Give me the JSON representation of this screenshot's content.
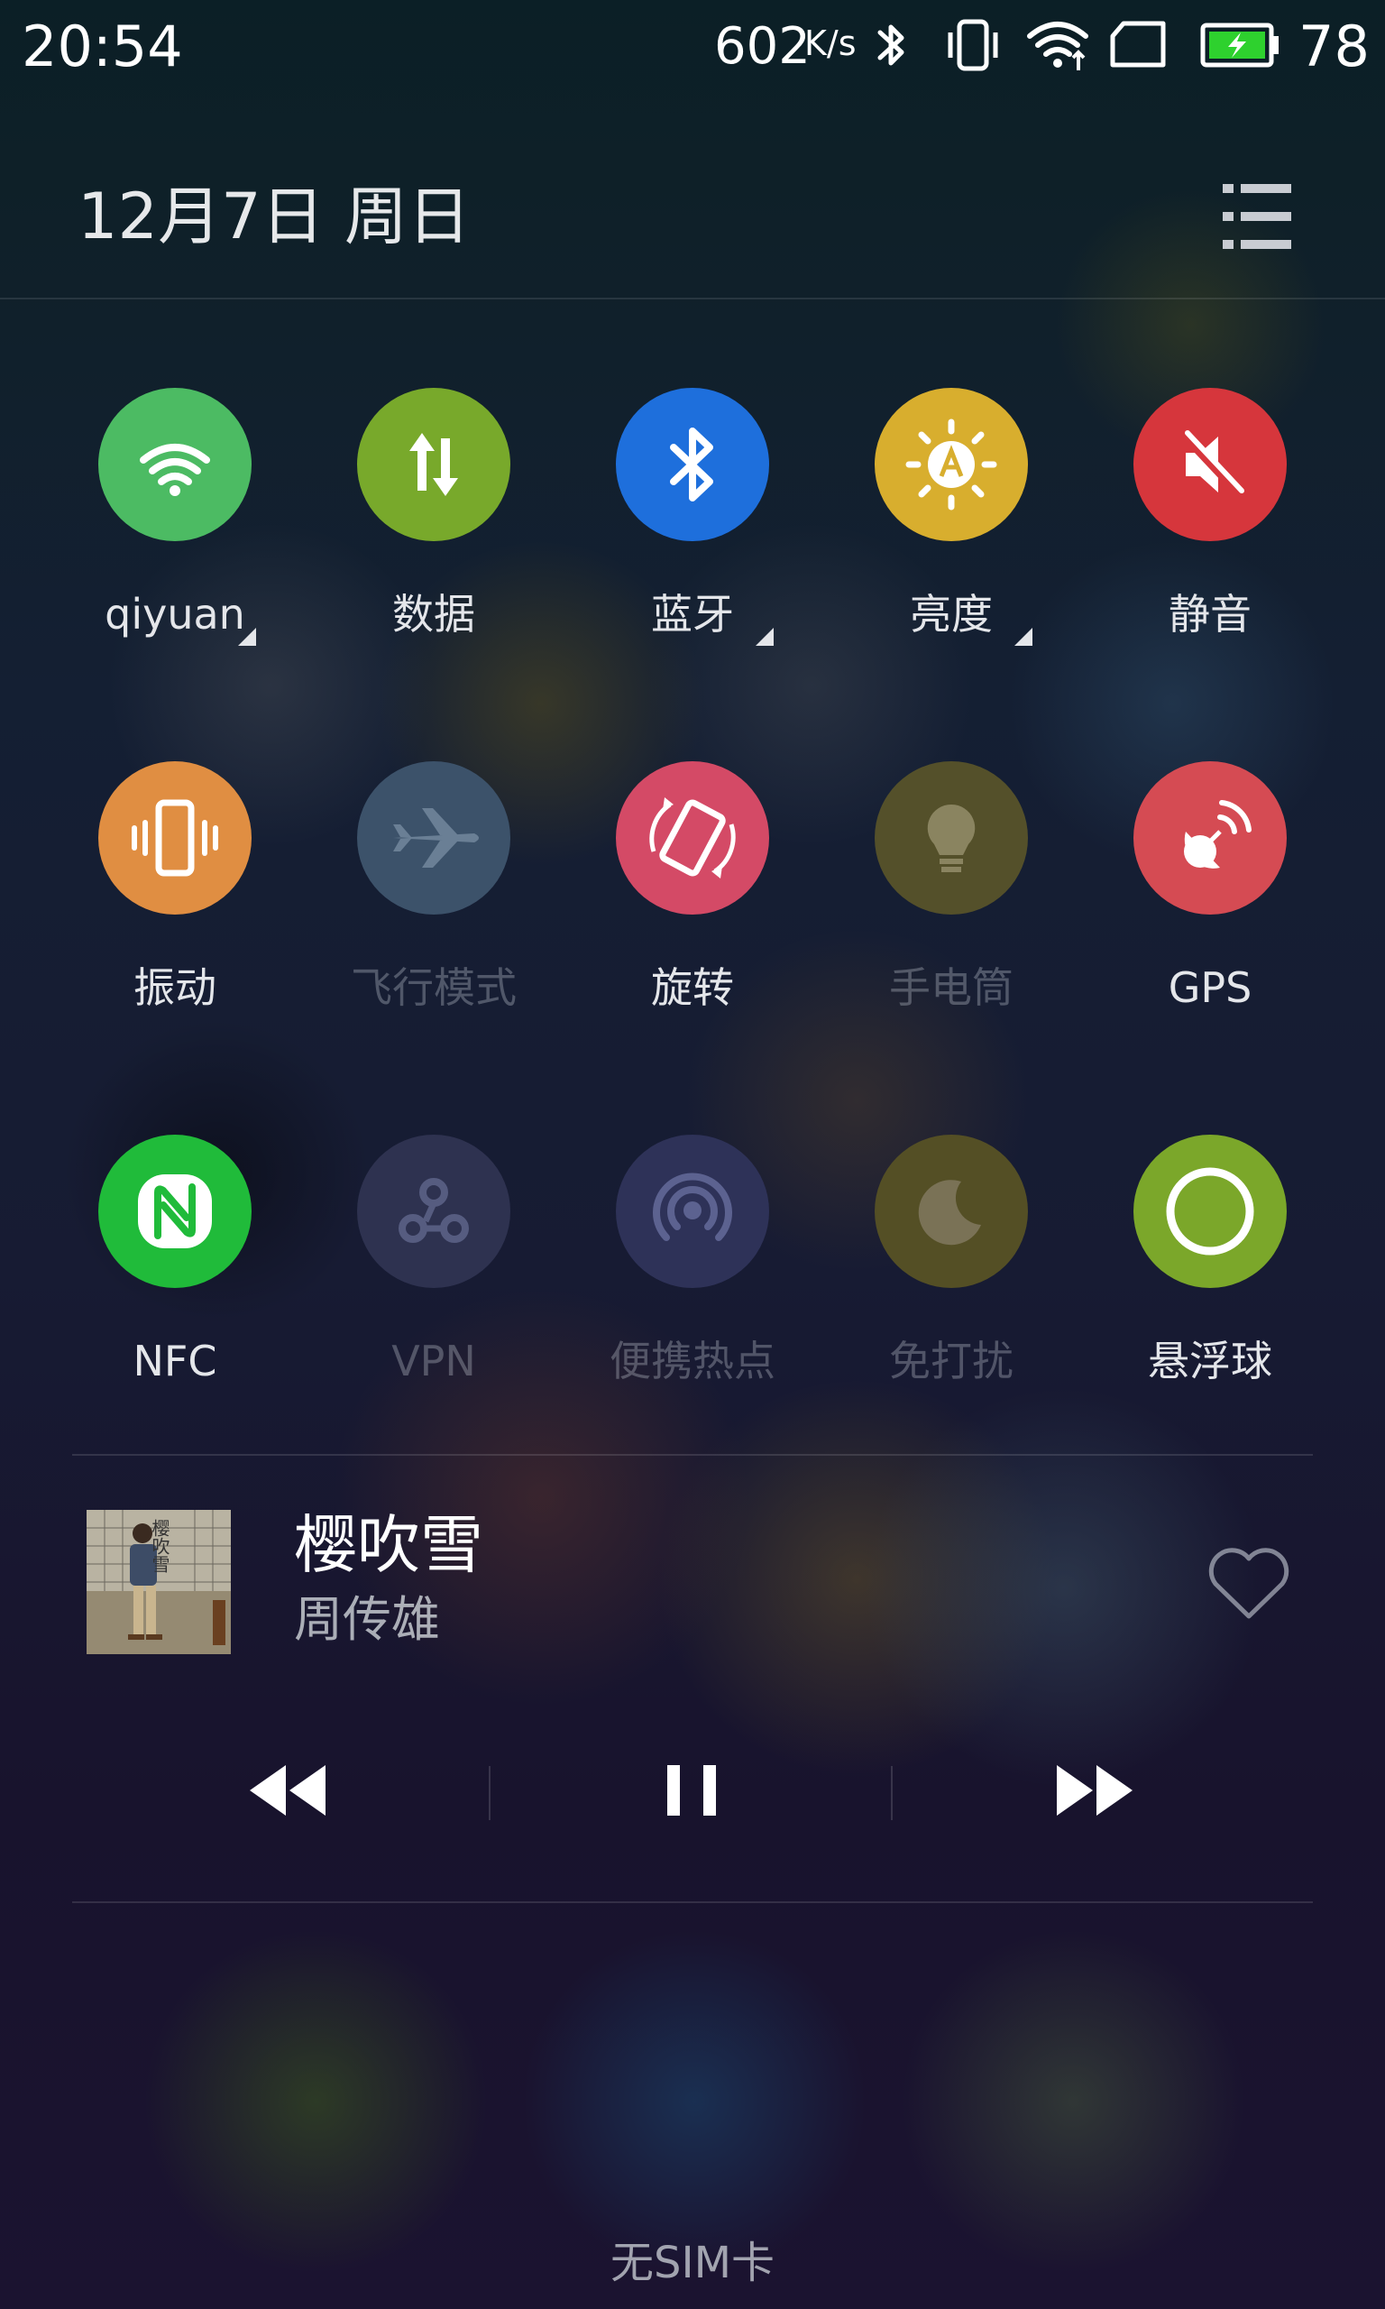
{
  "status_bar": {
    "time": "20:54",
    "net_speed": "602",
    "net_speed_unit": "K/s",
    "battery_level": "78",
    "battery_color": "#2ed12e",
    "icons": [
      "bluetooth-icon",
      "vibrate-icon",
      "wifi-icon",
      "no-sim-icon",
      "battery-charging-icon"
    ]
  },
  "header": {
    "date": "12月7日  周日",
    "menu_icon": "list-icon"
  },
  "toggles": [
    {
      "label": "qiyuan",
      "icon": "wifi-icon",
      "color": "#4cbb63",
      "active": true,
      "has_caret": true
    },
    {
      "label": "数据",
      "icon": "data-icon",
      "color": "#78a92b",
      "active": true,
      "has_caret": false
    },
    {
      "label": "蓝牙",
      "icon": "bluetooth-icon",
      "color": "#1e6fdc",
      "active": true,
      "has_caret": true
    },
    {
      "label": "亮度",
      "icon": "brightness-auto-icon",
      "color": "#d8ae2e",
      "active": true,
      "has_caret": true
    },
    {
      "label": "静音",
      "icon": "mute-icon",
      "color": "#d6363c",
      "active": true,
      "has_caret": false
    },
    {
      "label": "振动",
      "icon": "vibrate-icon",
      "color": "#e08e42",
      "active": true,
      "has_caret": false
    },
    {
      "label": "飞行模式",
      "icon": "airplane-icon",
      "color": "#3c526a",
      "active": false,
      "has_caret": false
    },
    {
      "label": "旋转",
      "icon": "rotate-icon",
      "color": "#d44a66",
      "active": true,
      "has_caret": false
    },
    {
      "label": "手电筒",
      "icon": "flashlight-icon",
      "color": "#54502a",
      "active": false,
      "has_caret": false
    },
    {
      "label": "GPS",
      "icon": "gps-icon",
      "color": "#d54b53",
      "active": true,
      "has_caret": false
    },
    {
      "label": "NFC",
      "icon": "nfc-icon",
      "color": "#20bb3a",
      "active": true,
      "has_caret": false
    },
    {
      "label": "VPN",
      "icon": "vpn-icon",
      "color": "#2e3250",
      "active": false,
      "has_caret": false
    },
    {
      "label": "便携热点",
      "icon": "hotspot-icon",
      "color": "#2e3258",
      "active": false,
      "has_caret": false
    },
    {
      "label": "免打扰",
      "icon": "moon-icon",
      "color": "#544f25",
      "active": false,
      "has_caret": false
    },
    {
      "label": "悬浮球",
      "icon": "floating-ball-icon",
      "color": "#7ba72a",
      "active": true,
      "has_caret": false
    }
  ],
  "music": {
    "title": "樱吹雪",
    "artist": "周传雄",
    "album_art_text": "樱吹雪",
    "favorite_icon": "heart-icon",
    "controls": [
      "previous-icon",
      "pause-icon",
      "next-icon"
    ]
  },
  "carrier": "无SIM卡"
}
